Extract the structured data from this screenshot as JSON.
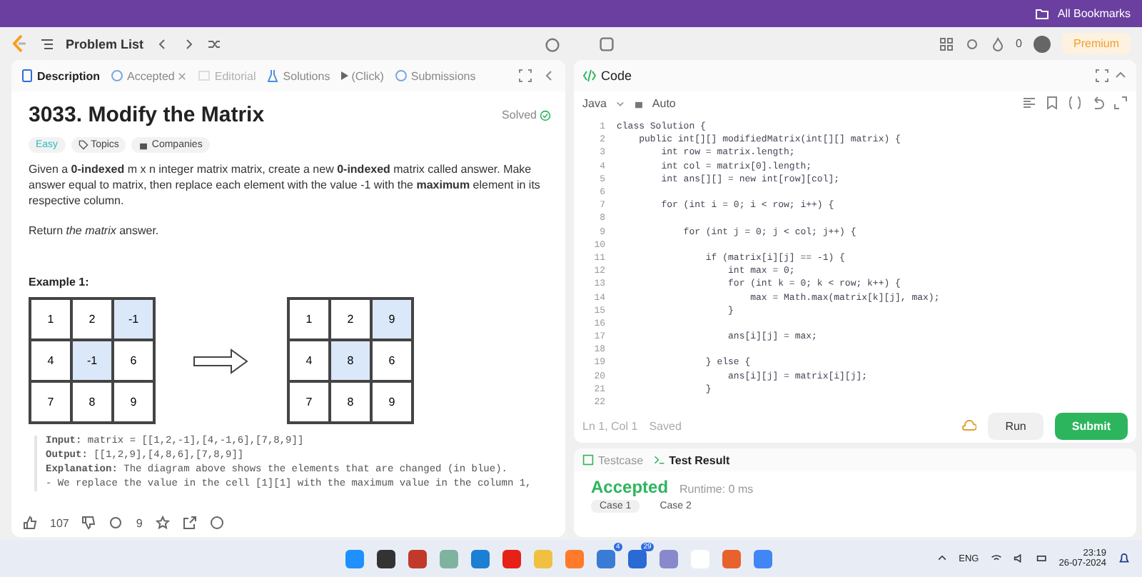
{
  "bookmarks_bar": {
    "label": "All Bookmarks"
  },
  "header": {
    "problem_list": "Problem List",
    "streak": "0",
    "premium": "Premium"
  },
  "tabs": [
    {
      "label": "Description",
      "selected": true,
      "disabled": false,
      "closable": false
    },
    {
      "label": "Accepted",
      "selected": false,
      "disabled": false,
      "closable": true
    },
    {
      "label": "Editorial",
      "selected": false,
      "disabled": true,
      "closable": false
    },
    {
      "label": "Solutions",
      "selected": false,
      "disabled": false,
      "closable": false
    },
    {
      "label": "(Click)",
      "selected": false,
      "disabled": false,
      "closable": false
    },
    {
      "label": "Submissions",
      "selected": false,
      "disabled": false,
      "closable": false
    }
  ],
  "problem": {
    "title": "3033. Modify the Matrix",
    "status": "Solved",
    "difficulty": "Easy",
    "tags": [
      "Topics",
      "Companies"
    ],
    "paragraphs": [
      "Given a **0-indexed** m x n integer matrix matrix, create a new **0-indexed** matrix called answer. Make answer equal to matrix, then replace each element with the value -1 with the **maximum** element in its respective column.",
      "Return *the matrix* answer."
    ],
    "example_title": "Example 1:",
    "input_grid": [
      [
        {
          "v": "1",
          "highlighted": false
        },
        {
          "v": "2",
          "highlighted": false
        },
        {
          "v": "-1",
          "highlighted": true
        }
      ],
      [
        {
          "v": "4",
          "highlighted": false
        },
        {
          "v": "-1",
          "highlighted": true
        },
        {
          "v": "6",
          "highlighted": false
        }
      ],
      [
        {
          "v": "7",
          "highlighted": false
        },
        {
          "v": "8",
          "highlighted": false
        },
        {
          "v": "9",
          "highlighted": false
        }
      ]
    ],
    "output_grid": [
      [
        {
          "v": "1",
          "highlighted": false
        },
        {
          "v": "2",
          "highlighted": false
        },
        {
          "v": "9",
          "highlighted": true
        }
      ],
      [
        {
          "v": "4",
          "highlighted": false
        },
        {
          "v": "8",
          "highlighted": true
        },
        {
          "v": "6",
          "highlighted": false
        }
      ],
      [
        {
          "v": "7",
          "highlighted": false
        },
        {
          "v": "8",
          "highlighted": false
        },
        {
          "v": "9",
          "highlighted": false
        }
      ]
    ],
    "example_lines": [
      "**Input:** matrix = [[1,2,-1],[4,-1,6],[7,8,9]]",
      "**Output:** [[1,2,9],[4,8,6],[7,8,9]]",
      "**Explanation:** The diagram above shows the elements that are changed (in blue).",
      "- We replace the value in the cell [1][1] with the maximum value in the column 1,"
    ]
  },
  "footer": {
    "likes": "107",
    "comments": "9"
  },
  "code_panel": {
    "title": "Code",
    "language": "Java",
    "mode": "Auto",
    "position": "Ln 1, Col 1",
    "saved": "Saved",
    "run": "Run",
    "submit": "Submit",
    "lines": [
      {
        "n": "1",
        "text": "class Solution {"
      },
      {
        "n": "2",
        "text": "    public int[][] modifiedMatrix(int[][] matrix) {"
      },
      {
        "n": "3",
        "text": "        int row = matrix.length;"
      },
      {
        "n": "4",
        "text": "        int col = matrix[0].length;"
      },
      {
        "n": "5",
        "text": "        int ans[][] = new int[row][col];"
      },
      {
        "n": "6"
      },
      {
        "n": "7",
        "text": "        for (int i = 0; i < row; i++) {"
      },
      {
        "n": "8"
      },
      {
        "n": "9",
        "text": "            for (int j = 0; j < col; j++) {"
      },
      {
        "n": "10"
      },
      {
        "n": "11",
        "text": "                if (matrix[i][j] == -1) {"
      },
      {
        "n": "12",
        "text": "                    int max = 0;"
      },
      {
        "n": "13",
        "text": "                    for (int k = 0; k < row; k++) {"
      },
      {
        "n": "14",
        "text": "                        max = Math.max(matrix[k][j], max);"
      },
      {
        "n": "15",
        "text": "                    }"
      },
      {
        "n": "16"
      },
      {
        "n": "17",
        "text": "                    ans[i][j] = max;"
      },
      {
        "n": "18"
      },
      {
        "n": "19",
        "text": "                } else {"
      },
      {
        "n": "20",
        "text": "                    ans[i][j] = matrix[i][j];"
      },
      {
        "n": "21",
        "text": "                }"
      },
      {
        "n": "22"
      }
    ]
  },
  "result_panel": {
    "tabs": [
      {
        "label": "Testcase",
        "selected": false
      },
      {
        "label": "Test Result",
        "selected": true
      }
    ],
    "verdict": "Accepted",
    "runtime": "Runtime: 0 ms",
    "cases": [
      {
        "label": "Case 1",
        "selected": true
      },
      {
        "label": "Case 2",
        "selected": false
      }
    ]
  },
  "taskbar": {
    "badges": [
      "4",
      "29"
    ],
    "language": "ENG",
    "time": "23:19",
    "date": "26-07-2024"
  }
}
